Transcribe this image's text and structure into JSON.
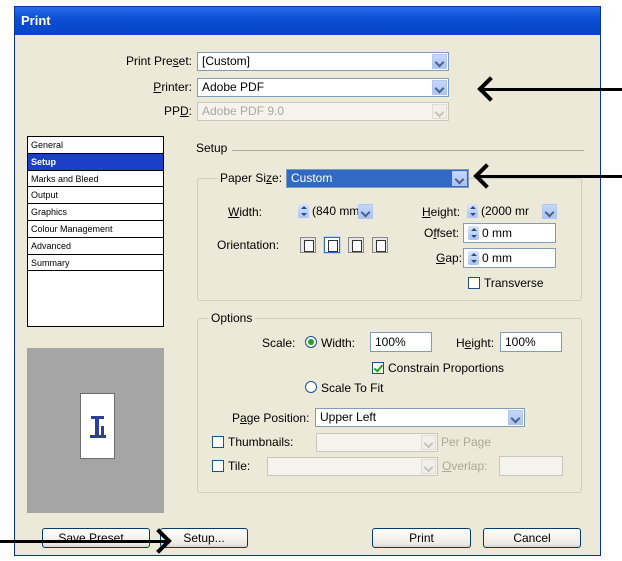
{
  "window": {
    "title": "Print"
  },
  "print_preset": {
    "label": "Print Preset:",
    "value": "[Custom]"
  },
  "printer": {
    "label": "Printer:",
    "value": "Adobe PDF"
  },
  "ppd": {
    "label": "PPD:",
    "value": "Adobe PDF 9.0"
  },
  "sidebar": {
    "items": [
      "General",
      "Setup",
      "Marks and Bleed",
      "Output",
      "Graphics",
      "Colour Management",
      "Advanced",
      "Summary"
    ],
    "selected": "Setup"
  },
  "setup": {
    "heading": "Setup",
    "paper_size_label": "Paper Size:",
    "paper_size_value": "Custom",
    "width_label": "Width:",
    "width_value": "(840 mm",
    "height_label": "Height:",
    "height_value": "(2000 mr",
    "offset_label": "Offset:",
    "offset_value": "0 mm",
    "gap_label": "Gap:",
    "gap_value": "0 mm",
    "orientation_label": "Orientation:",
    "transverse_label": "Transverse"
  },
  "options": {
    "heading": "Options",
    "scale_label": "Scale:",
    "width_label": "Width:",
    "width_value": "100%",
    "height_label": "Height:",
    "height_value": "100%",
    "constrain_label": "Constrain Proportions",
    "scale_to_fit_label": "Scale To Fit",
    "page_position_label": "Page Position:",
    "page_position_value": "Upper Left",
    "thumbnails_label": "Thumbnails:",
    "per_page_label": "Per Page",
    "tile_label": "Tile:",
    "overlap_label": "Overlap:"
  },
  "buttons": {
    "save_preset": "Save Preset...",
    "setup": "Setup...",
    "print": "Print",
    "cancel": "Cancel"
  },
  "colors": {
    "titlebar": "#0a4fd6",
    "selection": "#1b3fc9",
    "dialog_bg": "#ece9d8"
  }
}
